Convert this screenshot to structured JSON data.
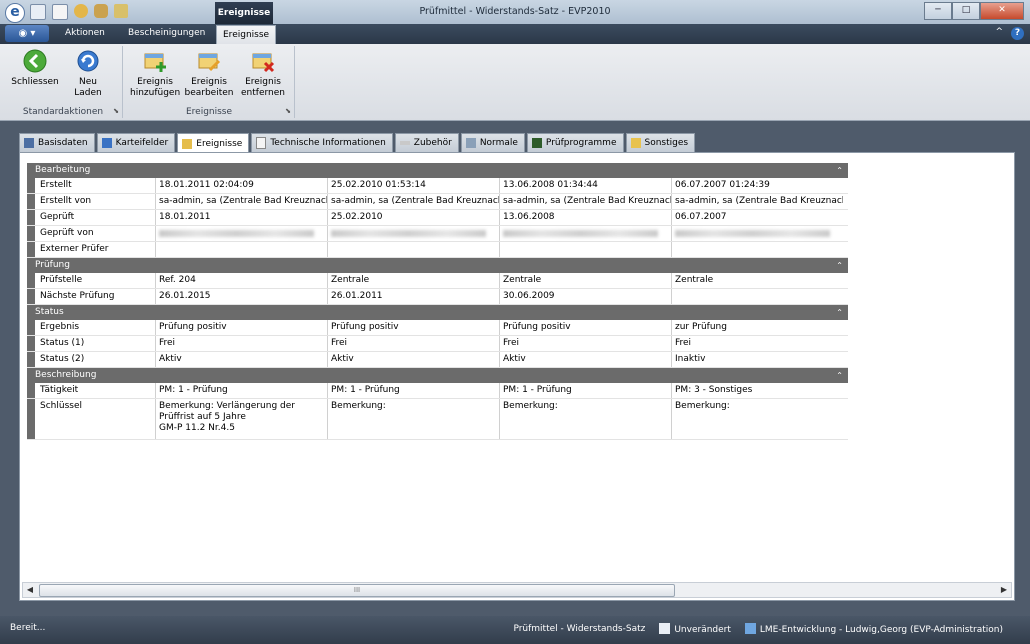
{
  "window": {
    "title": "Prüfmittel - Widerstands-Satz - EVP2010",
    "context_tab": "Ereignisse",
    "minimize": "─",
    "maximize": "□",
    "close": "✕"
  },
  "app_menu_label": "◉ ▾",
  "ribbon_tabs": [
    {
      "label": "Aktionen"
    },
    {
      "label": "Bescheinigungen"
    },
    {
      "label": "Ereignisse"
    }
  ],
  "help_controls": {
    "collapse": "^",
    "help": "?"
  },
  "ribbon_groups": {
    "standard": {
      "label": "Standardaktionen",
      "buttons": [
        {
          "label": "Schliessen",
          "icon": "back-arrow-icon"
        },
        {
          "label": "Neu Laden",
          "icon": "reload-icon"
        }
      ]
    },
    "events": {
      "label": "Ereignisse",
      "buttons": [
        {
          "label_1": "Ereignis",
          "label_2": "hinzufügen",
          "icon": "event-add-icon"
        },
        {
          "label_1": "Ereignis",
          "label_2": "bearbeiten",
          "icon": "event-edit-icon"
        },
        {
          "label_1": "Ereignis",
          "label_2": "entfernen",
          "icon": "event-remove-icon"
        }
      ]
    }
  },
  "tabs": [
    {
      "label": "Basisdaten",
      "active": false
    },
    {
      "label": "Karteifelder",
      "active": false
    },
    {
      "label": "Ereignisse",
      "active": true
    },
    {
      "label": "Technische Informationen",
      "active": false
    },
    {
      "label": "Zubehör",
      "active": false
    },
    {
      "label": "Normale",
      "active": false
    },
    {
      "label": "Prüfprogramme",
      "active": false
    },
    {
      "label": "Sonstiges",
      "active": false
    }
  ],
  "grid": {
    "sections": [
      {
        "title": "Bearbeitung",
        "rows": [
          {
            "label": "Erstellt",
            "cells": [
              "18.01.2011 02:04:09",
              "25.02.2010 01:53:14",
              "13.06.2008 01:34:44",
              "06.07.2007 01:24:39"
            ]
          },
          {
            "label": "Erstellt von",
            "cells": [
              "sa-admin, sa (Zentrale Bad Kreuznach)",
              "sa-admin, sa (Zentrale Bad Kreuznach)",
              "sa-admin, sa (Zentrale Bad Kreuznach)",
              "sa-admin, sa (Zentrale Bad Kreuznach)"
            ]
          },
          {
            "label": "Geprüft",
            "cells": [
              "18.01.2011",
              "25.02.2010",
              "13.06.2008",
              "06.07.2007"
            ]
          },
          {
            "label": "Geprüft von",
            "cells": [
              "",
              "",
              "",
              ""
            ],
            "blurred": true
          },
          {
            "label": "Externer Prüfer",
            "cells": [
              "",
              "",
              "",
              ""
            ]
          }
        ]
      },
      {
        "title": "Prüfung",
        "rows": [
          {
            "label": "Prüfstelle",
            "cells": [
              "Ref. 204",
              "Zentrale",
              "Zentrale",
              "Zentrale"
            ]
          },
          {
            "label": "Nächste Prüfung",
            "cells": [
              "26.01.2015",
              "26.01.2011",
              "30.06.2009",
              ""
            ]
          }
        ]
      },
      {
        "title": "Status",
        "rows": [
          {
            "label": "Ergebnis",
            "cells": [
              "Prüfung positiv",
              "Prüfung positiv",
              "Prüfung positiv",
              "zur Prüfung"
            ]
          },
          {
            "label": "Status (1)",
            "cells": [
              "Frei",
              "Frei",
              "Frei",
              "Frei"
            ]
          },
          {
            "label": "Status (2)",
            "cells": [
              "Aktiv",
              "Aktiv",
              "Aktiv",
              "Inaktiv"
            ]
          }
        ]
      },
      {
        "title": "Beschreibung",
        "rows": [
          {
            "label": "Tätigkeit",
            "cells": [
              "PM: 1 - Prüfung",
              "PM: 1 - Prüfung",
              "PM: 1 - Prüfung",
              "PM: 3 - Sonstiges"
            ]
          },
          {
            "label": "Schlüssel",
            "tall": true,
            "cells": [
              "Bemerkung: Verlängerung der Prüffrist auf 5 Jahre\nGM-P 11.2 Nr.4.5",
              "Bemerkung:",
              "Bemerkung:",
              "Bemerkung:"
            ]
          }
        ]
      }
    ]
  },
  "scrollbar": {
    "left": "◀",
    "right": "▶",
    "grip": "III"
  },
  "status": {
    "left": "Bereit...",
    "context": "Prüfmittel - Widerstands-Satz",
    "state": "Unverändert",
    "user": "LME-Entwicklung - Ludwig,Georg (EVP-Administration)"
  },
  "colors": {
    "section_header": "#6b6b6b",
    "frame": "#4f5b6b",
    "active_context_tab": "#1d2836"
  }
}
